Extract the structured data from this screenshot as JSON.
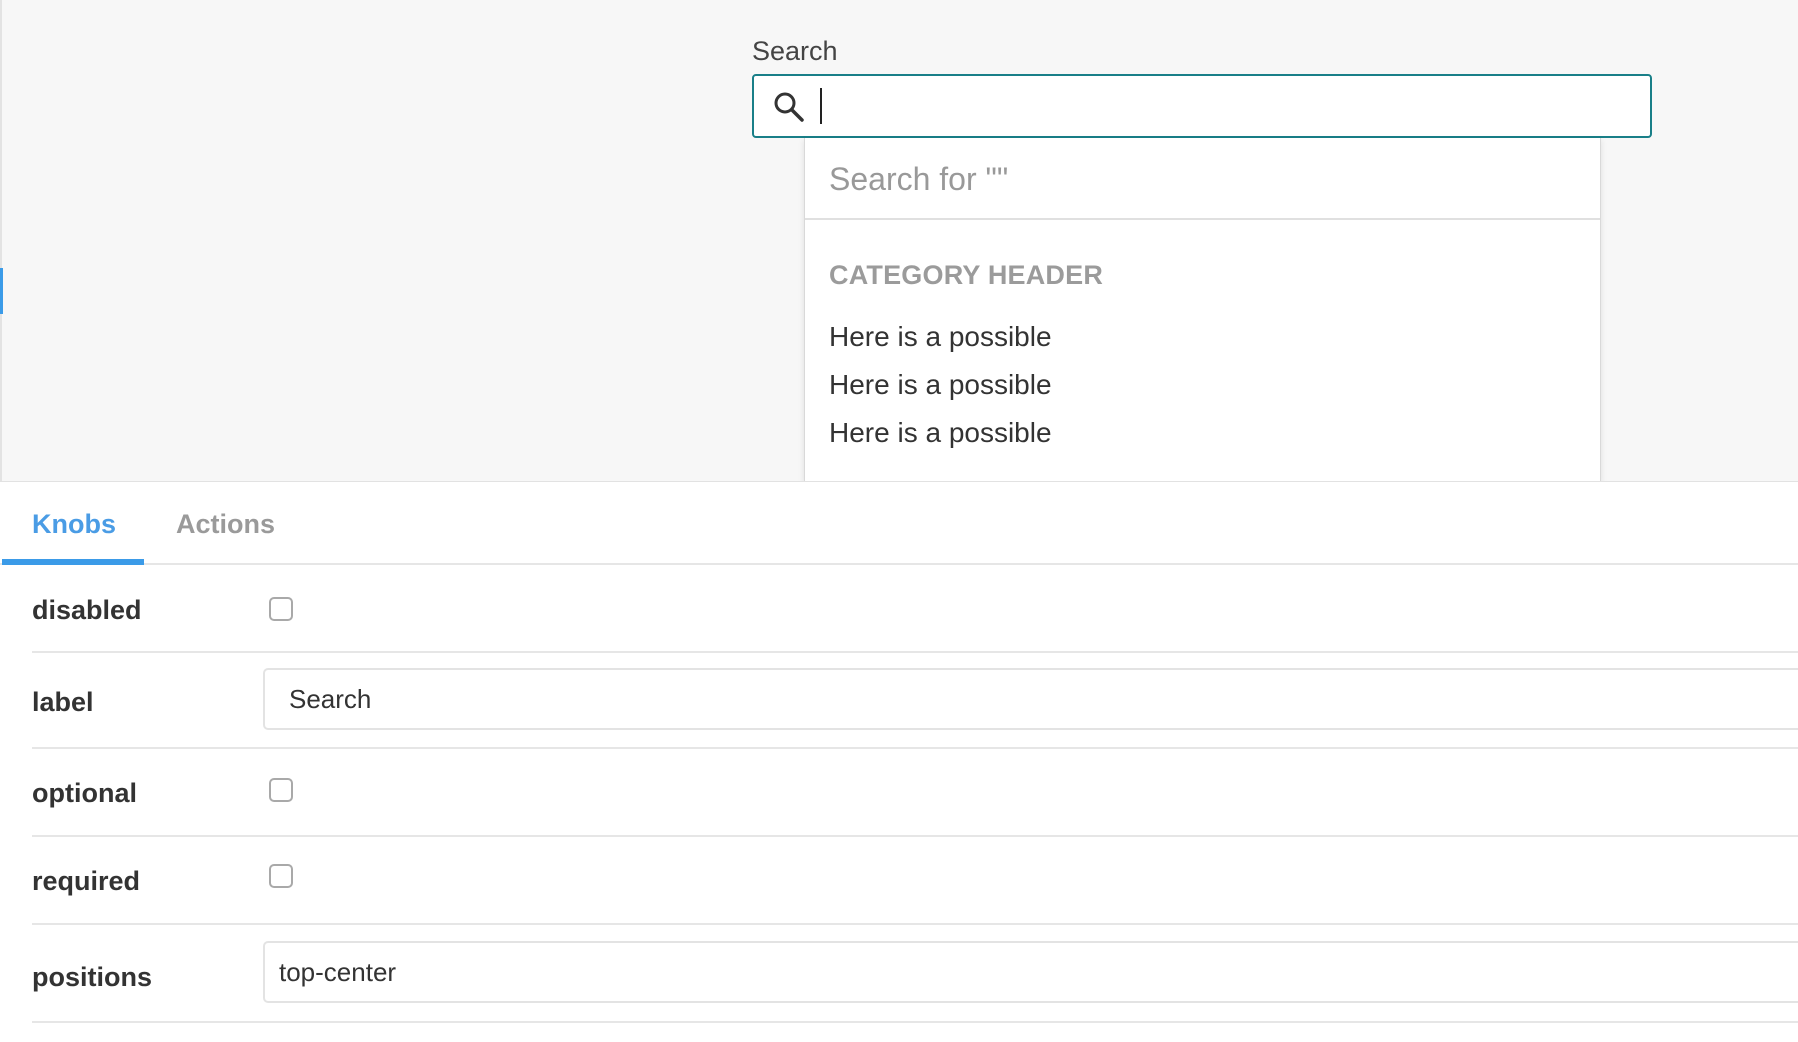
{
  "preview": {
    "search_label": "Search",
    "search_value": "",
    "dropdown": {
      "search_for": "Search for \"\"",
      "category_header": "CATEGORY HEADER",
      "options": [
        "Here is a possible",
        "Here is a possible",
        "Here is a possible"
      ]
    },
    "colors": {
      "focus_border": "#197f88",
      "accent": "#3b9be8"
    }
  },
  "addons": {
    "tabs": [
      {
        "label": "Knobs",
        "active": true
      },
      {
        "label": "Actions",
        "active": false
      }
    ]
  },
  "knobs": {
    "disabled": {
      "name": "disabled",
      "checked": false
    },
    "label": {
      "name": "label",
      "value": "Search"
    },
    "optional": {
      "name": "optional",
      "checked": false
    },
    "required": {
      "name": "required",
      "checked": false
    },
    "positions": {
      "name": "positions",
      "value": "top-center"
    }
  },
  "icons": {
    "search": "search-icon",
    "checkbox": "checkbox"
  }
}
